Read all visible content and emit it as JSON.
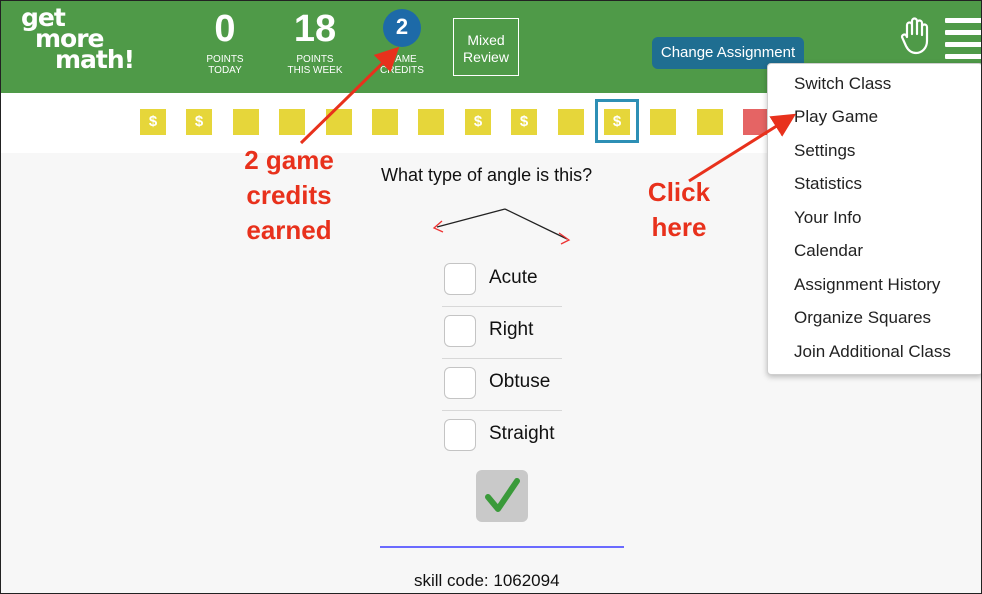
{
  "logo": {
    "line1": "get",
    "line2": "more",
    "line3": "math!"
  },
  "stats": {
    "points_today": {
      "value": "0",
      "label_l1": "POINTS",
      "label_l2": "TODAY"
    },
    "points_week": {
      "value": "18",
      "label_l1": "POINTS",
      "label_l2": "THIS WEEK"
    },
    "game_credits": {
      "value": "2",
      "label_l1": "GAME",
      "label_l2": "CREDITS"
    }
  },
  "mixed_review": {
    "line1": "Mixed",
    "line2": "Review"
  },
  "change_assignment": "Change Assignment",
  "squares": [
    {
      "symbol": "$",
      "state": "earned"
    },
    {
      "symbol": "$",
      "state": "earned"
    },
    {
      "symbol": "",
      "state": "empty"
    },
    {
      "symbol": "",
      "state": "empty"
    },
    {
      "symbol": "",
      "state": "empty"
    },
    {
      "symbol": "",
      "state": "empty"
    },
    {
      "symbol": "",
      "state": "empty"
    },
    {
      "symbol": "$",
      "state": "earned"
    },
    {
      "symbol": "$",
      "state": "earned"
    },
    {
      "symbol": "",
      "state": "empty"
    },
    {
      "symbol": "$",
      "state": "current"
    },
    {
      "symbol": "",
      "state": "empty"
    },
    {
      "symbol": "",
      "state": "empty"
    },
    {
      "symbol": "",
      "state": "wrong"
    }
  ],
  "question": "What type of angle is this?",
  "choices": [
    "Acute",
    "Right",
    "Obtuse",
    "Straight"
  ],
  "skill_code": "skill code: 1062094",
  "menu_items": [
    "Switch Class",
    "Play Game",
    "Settings",
    "Statistics",
    "Your Info",
    "Calendar",
    "Assignment History",
    "Organize Squares",
    "Join Additional Class"
  ],
  "annotations": {
    "credits_note": [
      "2 game",
      "credits",
      "earned"
    ],
    "click_note": [
      "Click",
      "here"
    ]
  },
  "colors": {
    "header_green": "#4f9a48",
    "credit_blue": "#1d6aa8",
    "button_blue": "#1f6e91",
    "square_yellow": "#e6d63a",
    "square_red": "#e56464",
    "annotation_red": "#e8311c",
    "check_green": "#3a9a3a"
  },
  "icons": {
    "hand": "raised-hand-icon",
    "menu": "hamburger-menu-icon",
    "check": "check-icon"
  }
}
